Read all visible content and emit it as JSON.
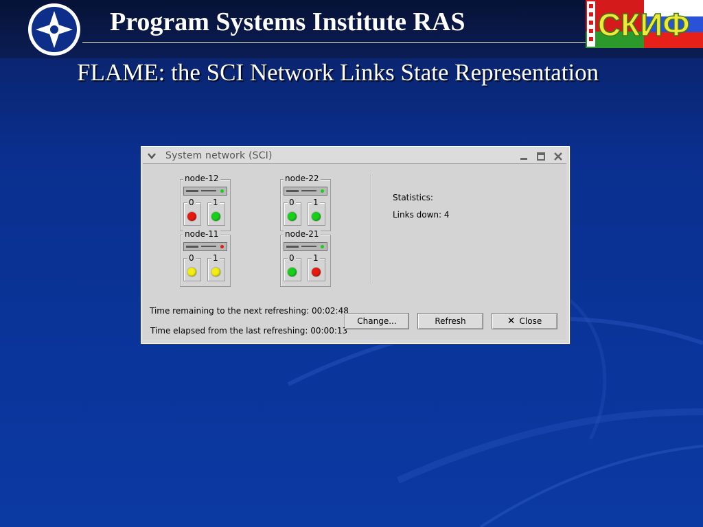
{
  "header": {
    "title": "Program Systems Institute RAS",
    "right_logo_text": "СКИФ"
  },
  "slide": {
    "title": "FLAME: the SCI Network Links State Representation"
  },
  "window": {
    "title": "System network (SCI)",
    "nodes": [
      {
        "name": "node-12",
        "switch_led": "green",
        "ports": [
          {
            "label": "0",
            "status": "red"
          },
          {
            "label": "1",
            "status": "green"
          }
        ]
      },
      {
        "name": "node-22",
        "switch_led": "green",
        "ports": [
          {
            "label": "0",
            "status": "green"
          },
          {
            "label": "1",
            "status": "green"
          }
        ]
      },
      {
        "name": "node-11",
        "switch_led": "red",
        "ports": [
          {
            "label": "0",
            "status": "yellow"
          },
          {
            "label": "1",
            "status": "yellow"
          }
        ]
      },
      {
        "name": "node-21",
        "switch_led": "green",
        "ports": [
          {
            "label": "0",
            "status": "green"
          },
          {
            "label": "1",
            "status": "red"
          }
        ]
      }
    ],
    "statistics": {
      "heading": "Statistics:",
      "links_down": "Links down: 4"
    },
    "time_remaining": "Time remaining to the next refreshing: 00:02:48",
    "time_elapsed": "Time elapsed from the last refreshing: 00:00:13",
    "buttons": {
      "change": "Change...",
      "refresh": "Refresh",
      "close": "Close"
    }
  },
  "colors": {
    "red": "#e8190f",
    "green": "#18d01a",
    "yellow": "#f2ee10",
    "background": "#0b3aa3"
  }
}
